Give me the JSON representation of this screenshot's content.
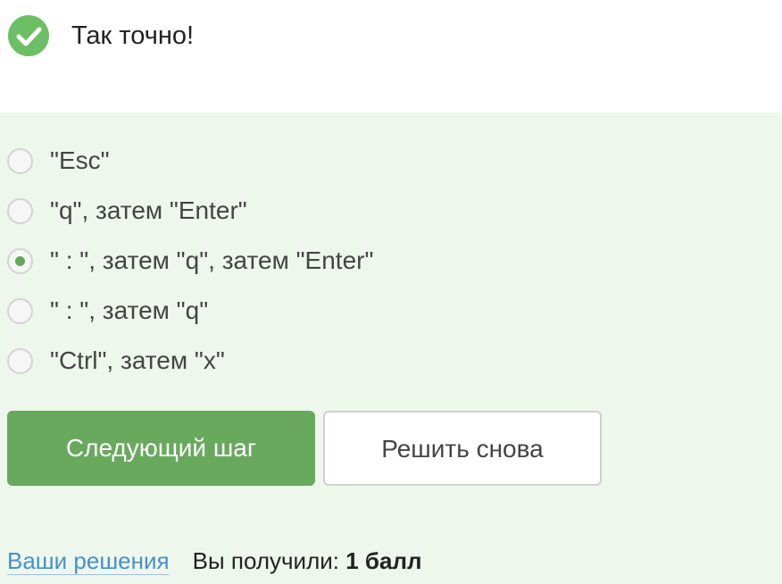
{
  "result": {
    "icon": "checkmark-circle-icon",
    "icon_color": "#6cbf64",
    "message": "Так точно!"
  },
  "options": [
    {
      "label": "\"Esc\"",
      "selected": false
    },
    {
      "label": "\"q\", затем \"Enter\"",
      "selected": false
    },
    {
      "label": "\" : \", затем \"q\", затем \"Enter\"",
      "selected": true
    },
    {
      "label": "\" : \", затем \"q\"",
      "selected": false
    },
    {
      "label": "\"Ctrl\", затем \"x\"",
      "selected": false
    }
  ],
  "buttons": {
    "next_step": "Следующий шаг",
    "solve_again": "Решить снова"
  },
  "footer": {
    "solutions_link": "Ваши решения",
    "score_label": "Вы получили:",
    "score_value": "1 балл"
  },
  "colors": {
    "panel_background": "#edf7eb",
    "primary_button": "#68a95e",
    "link": "#4a90c8"
  }
}
